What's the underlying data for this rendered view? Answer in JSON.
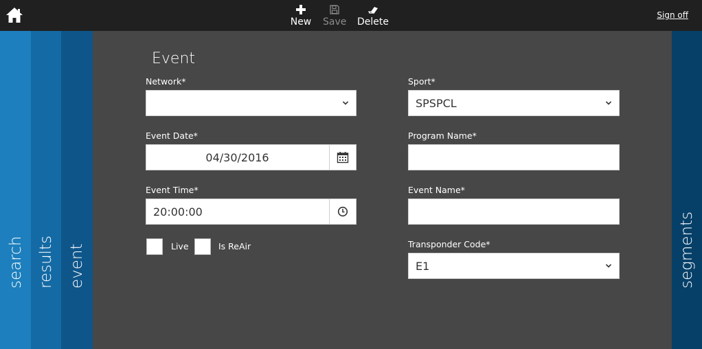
{
  "toolbar": {
    "new_label": "New",
    "save_label": "Save",
    "delete_label": "Delete",
    "signoff_label": "Sign off"
  },
  "tabs": {
    "search": "search",
    "results": "results",
    "event": "event",
    "segments": "segments"
  },
  "form": {
    "title": "Event",
    "network": {
      "label": "Network*",
      "value": ""
    },
    "event_date": {
      "label": "Event Date*",
      "value": "04/30/2016"
    },
    "event_time": {
      "label": "Event Time*",
      "value": "20:00:00"
    },
    "live": {
      "label": "Live",
      "checked": false
    },
    "is_reair": {
      "label": "Is ReAir",
      "checked": false
    },
    "sport": {
      "label": "Sport*",
      "value": "SPSPCL"
    },
    "program_name": {
      "label": "Program Name*",
      "value": ""
    },
    "event_name": {
      "label": "Event Name*",
      "value": ""
    },
    "transponder_code": {
      "label": "Transponder Code*",
      "value": "E1"
    }
  }
}
